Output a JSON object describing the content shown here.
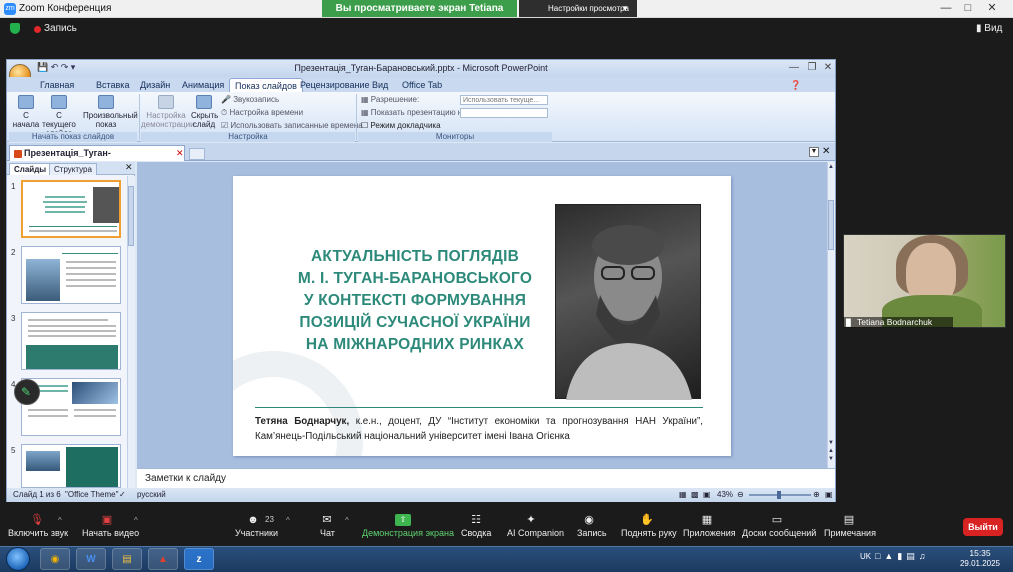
{
  "zoom": {
    "window_title": "Zoom Конференция",
    "share_banner": "Вы просматриваете экран Tetiana Bodnarchuk",
    "view_options": "Настройки просмотра",
    "recording": "Запись",
    "view": "Вид",
    "participant_count": "23",
    "participant_name": "Tetiana Bodnarchuk",
    "toolbar": {
      "audio": "Включить звук",
      "video": "Начать видео",
      "participants": "Участники",
      "chat": "Чат",
      "share": "Демонстрация экрана",
      "whiteboards": "Сводка",
      "ai": "AI Companion",
      "record": "Запись",
      "raise_hand": "Поднять руку",
      "apps": "Приложения",
      "boards": "Доски сообщений",
      "notes": "Примечания",
      "leave": "Выйти"
    }
  },
  "ppt": {
    "title": "Презентація_Туган-Барановський.pptx - Microsoft PowerPoint",
    "tabs": [
      "Главная",
      "Вставка",
      "Дизайн",
      "Анимация",
      "Показ слайдов",
      "Рецензирование",
      "Вид",
      "Office Tab"
    ],
    "active_tab": "Показ слайдов",
    "ribbon": {
      "from_start": "С начала",
      "from_current": "С текущего слайда",
      "custom_show": "Произвольный показ",
      "group_start": "Начать показ слайдов",
      "setup_show": "Настройка демонстрации",
      "hide_slide": "Скрыть слайд",
      "record_narration": "Звукозапись",
      "rehearse": "Настройка времени",
      "use_timings": "Использовать записанные времена",
      "group_setup": "Настройка",
      "resolution_label": "Разрешение:",
      "resolution_value": "Использовать текуще...",
      "show_on_label": "Показать презентацию на:",
      "presenter_view": "Режим докладчика",
      "group_monitors": "Мониторы"
    },
    "doc_tab": "Презентація_Туган-Барановський.pptx",
    "pane_tabs": [
      "Слайды",
      "Структура"
    ],
    "thumb_numbers": [
      "1",
      "2",
      "3",
      "4",
      "5"
    ],
    "slide": {
      "title_lines": [
        "АКТУАЛЬНІСТЬ ПОГЛЯДІВ",
        "М. І. ТУГАН-БАРАНОВСЬКОГО",
        "У КОНТЕКСТІ ФОРМУВАННЯ",
        "ПОЗИЦІЙ СУЧАСНОЇ УКРАЇНИ",
        "НА МІЖНАРОДНИХ РИНКАХ"
      ],
      "author_name": "Тетяна Боднарчук,",
      "author_rest": " к.е.н., доцент, ДУ “Інститут економіки та прогнозування НАН України”, Кам’янець-Подільський національний університет імені Івана Огієнка"
    },
    "notes_placeholder": "Заметки к слайду",
    "status": {
      "slide_of": "Слайд 1 из 6",
      "theme": "\"Office Theme\"",
      "language": "русский",
      "zoom": "43%"
    }
  },
  "taskbar": {
    "lang": "UK",
    "time": "15:35",
    "date": "29.01.2025"
  },
  "colors": {
    "accent_teal": "#2d8a7a",
    "share_green": "#3c9e4b",
    "leave_red": "#d92323"
  }
}
